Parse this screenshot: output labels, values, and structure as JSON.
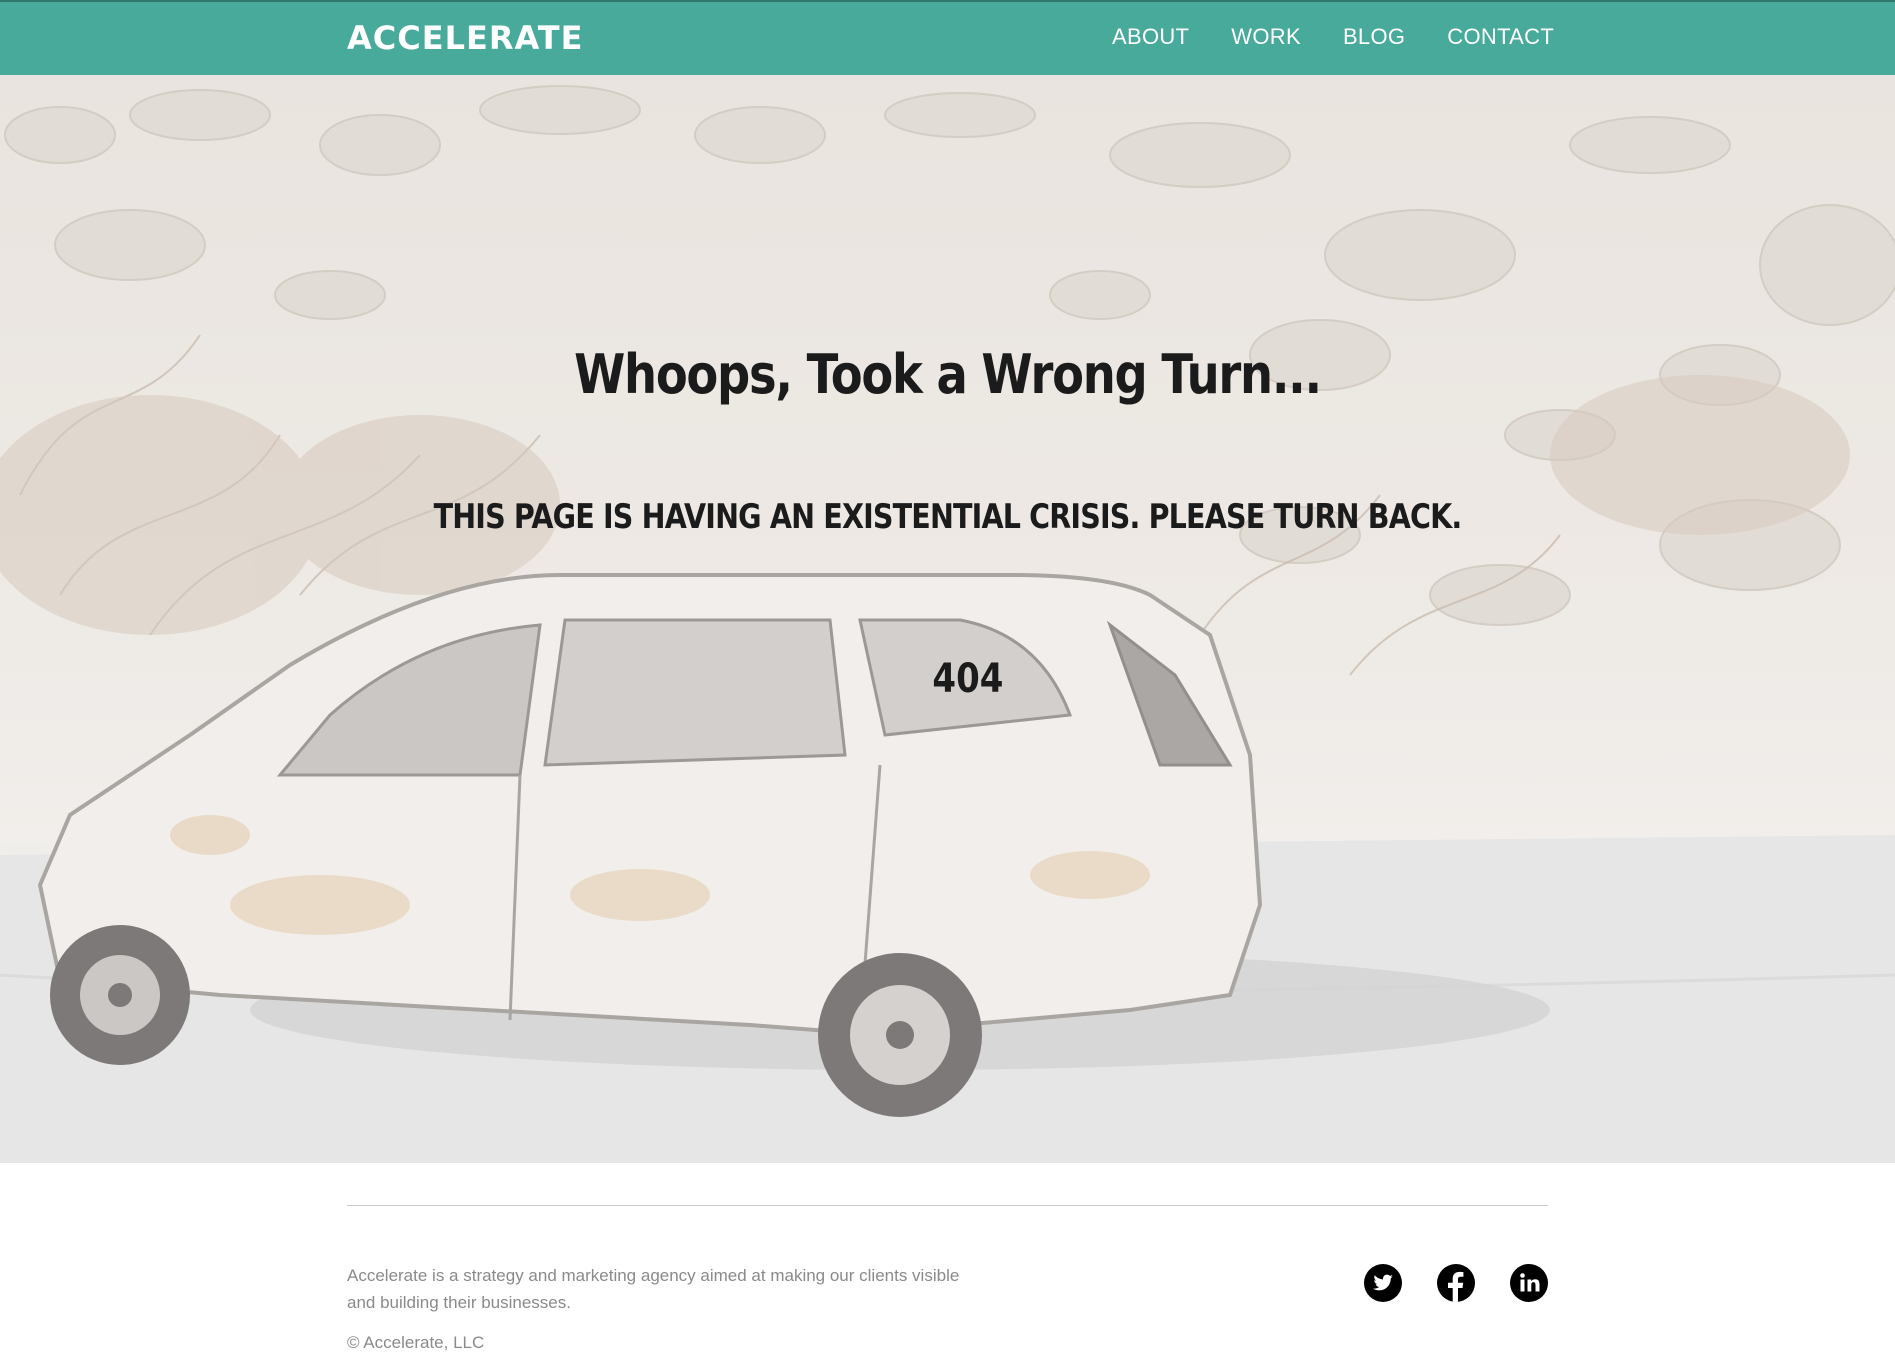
{
  "header": {
    "logo": "ACCELERATE",
    "nav": [
      {
        "label": "ABOUT"
      },
      {
        "label": "WORK"
      },
      {
        "label": "BLOG"
      },
      {
        "label": "CONTACT"
      }
    ]
  },
  "hero": {
    "title": "Whoops, Took a Wrong Turn...",
    "subtitle": "THIS PAGE IS HAVING AN EXISTENTIAL CRISIS. PLEASE TURN BACK.",
    "code": "404"
  },
  "footer": {
    "about": "Accelerate is a strategy and marketing agency aimed at making our clients visible and building their businesses.",
    "copyright": "© Accelerate, LLC",
    "social": [
      {
        "icon": "twitter-icon"
      },
      {
        "icon": "facebook-icon"
      },
      {
        "icon": "linkedin-icon"
      }
    ]
  },
  "colors": {
    "header_bg": "#47aa9b",
    "text_dark": "#1b1b1b",
    "footer_text": "#8a8a8a"
  }
}
